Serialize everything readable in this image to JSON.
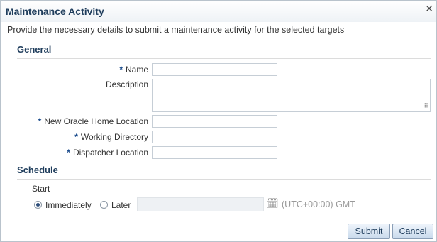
{
  "dialog": {
    "title": "Maintenance Activity",
    "close_icon": "close-icon",
    "intro": "Provide the necessary details to submit a maintenance activity for the selected targets"
  },
  "general": {
    "heading": "General",
    "name_label": "Name",
    "name_value": "",
    "description_label": "Description",
    "description_value": "",
    "oracle_home_label": "New Oracle Home Location",
    "oracle_home_value": "",
    "working_dir_label": "Working Directory",
    "working_dir_value": "",
    "dispatcher_label": "Dispatcher Location",
    "dispatcher_value": "",
    "required_marker": "*"
  },
  "schedule": {
    "heading": "Schedule",
    "start_label": "Start",
    "immediately_label": "Immediately",
    "later_label": "Later",
    "selected": "Immediately",
    "timezone": "(UTC+00:00) GMT",
    "calendar_icon": "calendar-icon"
  },
  "buttons": {
    "submit": "Submit",
    "cancel": "Cancel"
  }
}
